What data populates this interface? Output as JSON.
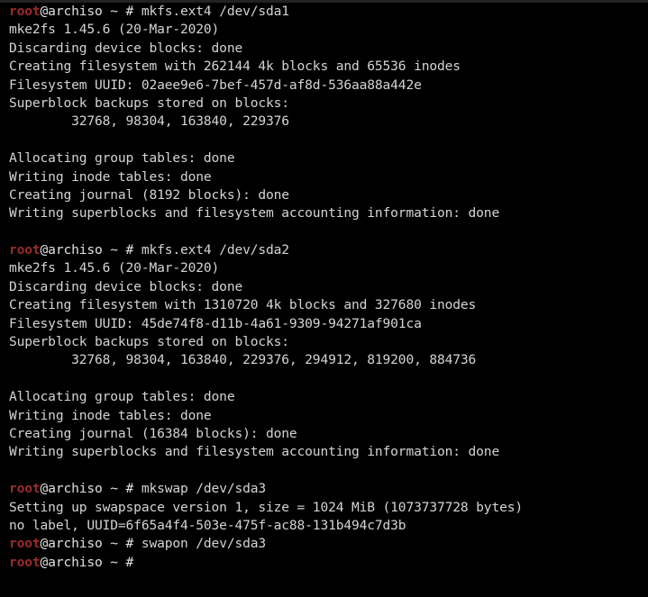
{
  "terminal": {
    "window_title": "",
    "background_color": "#000000",
    "foreground_color": "#d4d4d4",
    "prompt_user_color": "#9d2b2b",
    "prompt_user": "root",
    "prompt_host": "@archiso",
    "prompt_path": "~",
    "prompt_symbol": "#",
    "columns": 72,
    "rows": 32
  },
  "lines": [
    {
      "type": "prompt",
      "command": "mkfs.ext4 /dev/sda1"
    },
    {
      "type": "output",
      "text": "mke2fs 1.45.6 (20-Mar-2020)"
    },
    {
      "type": "output",
      "text": "Discarding device blocks: done"
    },
    {
      "type": "output",
      "text": "Creating filesystem with 262144 4k blocks and 65536 inodes"
    },
    {
      "type": "output",
      "text": "Filesystem UUID: 02aee9e6-7bef-457d-af8d-536aa88a442e"
    },
    {
      "type": "output",
      "text": "Superblock backups stored on blocks:"
    },
    {
      "type": "output",
      "text": "        32768, 98304, 163840, 229376"
    },
    {
      "type": "blank",
      "text": " "
    },
    {
      "type": "output",
      "text": "Allocating group tables: done"
    },
    {
      "type": "output",
      "text": "Writing inode tables: done"
    },
    {
      "type": "output",
      "text": "Creating journal (8192 blocks): done"
    },
    {
      "type": "output",
      "text": "Writing superblocks and filesystem accounting information: done"
    },
    {
      "type": "blank",
      "text": " "
    },
    {
      "type": "prompt",
      "command": "mkfs.ext4 /dev/sda2"
    },
    {
      "type": "output",
      "text": "mke2fs 1.45.6 (20-Mar-2020)"
    },
    {
      "type": "output",
      "text": "Discarding device blocks: done"
    },
    {
      "type": "output",
      "text": "Creating filesystem with 1310720 4k blocks and 327680 inodes"
    },
    {
      "type": "output",
      "text": "Filesystem UUID: 45de74f8-d11b-4a61-9309-94271af901ca"
    },
    {
      "type": "output",
      "text": "Superblock backups stored on blocks:"
    },
    {
      "type": "output",
      "text": "        32768, 98304, 163840, 229376, 294912, 819200, 884736"
    },
    {
      "type": "blank",
      "text": " "
    },
    {
      "type": "output",
      "text": "Allocating group tables: done"
    },
    {
      "type": "output",
      "text": "Writing inode tables: done"
    },
    {
      "type": "output",
      "text": "Creating journal (16384 blocks): done"
    },
    {
      "type": "output",
      "text": "Writing superblocks and filesystem accounting information: done"
    },
    {
      "type": "blank",
      "text": " "
    },
    {
      "type": "prompt",
      "command": "mkswap /dev/sda3"
    },
    {
      "type": "output",
      "text": "Setting up swapspace version 1, size = 1024 MiB (1073737728 bytes)"
    },
    {
      "type": "output",
      "text": "no label, UUID=6f65a4f4-503e-475f-ac88-131b494c7d3b"
    },
    {
      "type": "prompt",
      "command": "swapon /dev/sda3"
    },
    {
      "type": "prompt",
      "command": ""
    }
  ]
}
